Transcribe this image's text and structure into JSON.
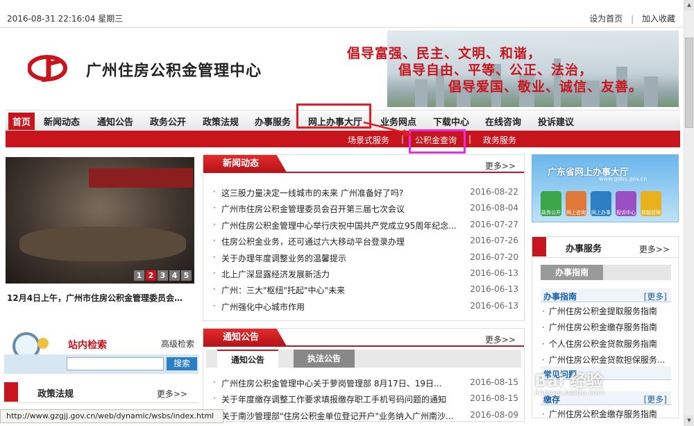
{
  "topbar": {
    "datetime": "2016-08-31 22:16:04 星期三",
    "set_home": "设为首页",
    "sep": "|",
    "favorite": "加入收藏"
  },
  "header": {
    "logo_text": "广州住房公积金管理中心",
    "slogan_line1": "倡导富强、民主、文明、和谐，",
    "slogan_line2": "倡导自由、平等、公正、法治，",
    "slogan_line3": "倡导爱国、敬业、诚信、友善。"
  },
  "nav": {
    "items": [
      "首页",
      "新闻动态",
      "通知公告",
      "政务公开",
      "政策法规",
      "办事服务",
      "网上办事大厅",
      "业务网点",
      "下载中心",
      "在线咨询",
      "投诉建议"
    ]
  },
  "subnav": {
    "items": [
      "场景式服务",
      "公积金查询",
      "政务服务"
    ],
    "sep": "|"
  },
  "slideshow": {
    "pages": [
      "1",
      "2",
      "3",
      "4",
      "5"
    ],
    "caption": "12月4日上午，广州市住房公积金管理委员会…"
  },
  "news": {
    "title": "新闻动态",
    "more": "更多>>",
    "items": [
      {
        "title": "这三股力量决定一线城市的未来 广州准备好了吗?",
        "date": "2016-08-22"
      },
      {
        "title": "广州市住房公积金管理委员会召开第三届七次会议",
        "date": "2016-08-04"
      },
      {
        "title": "广州住房公积金管理中心举行庆祝中国共产党成立95周年纪念...",
        "date": "2016-07-27"
      },
      {
        "title": "住房公积金业务，还可通过六大移动平台登录办理",
        "date": "2016-07-26"
      },
      {
        "title": "关于办理年度调整业务的温馨提示",
        "date": "2016-07-20"
      },
      {
        "title": "北上广深显露经济发展新活力",
        "date": "2016-06-13"
      },
      {
        "title": "广州：三大\"枢纽\"托起\"中心\"未来",
        "date": "2016-06-13"
      },
      {
        "title": "广州强化中心城市作用",
        "date": "2016-06-13"
      }
    ]
  },
  "notices": {
    "title": "通知公告",
    "more": "更多>>",
    "tab_active": "通知公告",
    "tab_other": "执法公告",
    "items": [
      {
        "title": "广州住房公积金管理中心关于萝岗管理部 8月17日、19日...",
        "date": "2016-08-15"
      },
      {
        "title": "关于年度缴存调整工作要求填报缴存职工手机号码问题的通知",
        "date": "2016-08-15"
      },
      {
        "title": "关于南沙管理部\"住房公积金单位登记开户\"业务纳入广州南沙...",
        "date": "2016-08-09"
      }
    ]
  },
  "search": {
    "title": "站内检索",
    "advanced": "高级检索",
    "button": "搜索",
    "value": ""
  },
  "policy": {
    "title": "政策法规",
    "more": "更多>>"
  },
  "gd_hall": {
    "title": "广东省网上办事大厅",
    "url": "www.gdbs.gov.cn",
    "icons": [
      "政务公开",
      "网上咨询",
      "网上办事",
      "投诉中心",
      "效能监察"
    ],
    "icon_colors": [
      "#3aa64a",
      "#e0783a",
      "#2c7fc2",
      "#9a4fc2",
      "#e8b21c"
    ]
  },
  "services": {
    "title": "办事服务",
    "more": "更多>>",
    "guide_tab": "办事指南",
    "section1": "办事指南",
    "section1_more": "[更多]",
    "guides": [
      "广州住房公积金提取服务指南",
      "广州住房公积金缴存服务指南",
      "个人住房公积金贷款服务指南",
      "广州住房公积金贷款担保服务..."
    ],
    "section2": "常见问题",
    "section3": "缴存",
    "section3_more": "[更多]",
    "faq": [
      "广州住房公积金缴存服务指南"
    ]
  },
  "watermark": {
    "main": "Bai 经验",
    "sub": "jingyan.baidu.com"
  },
  "statusbar": {
    "url": "http://www.gzgjj.gov.cn/web/dynamic/wsbs/index.html"
  }
}
